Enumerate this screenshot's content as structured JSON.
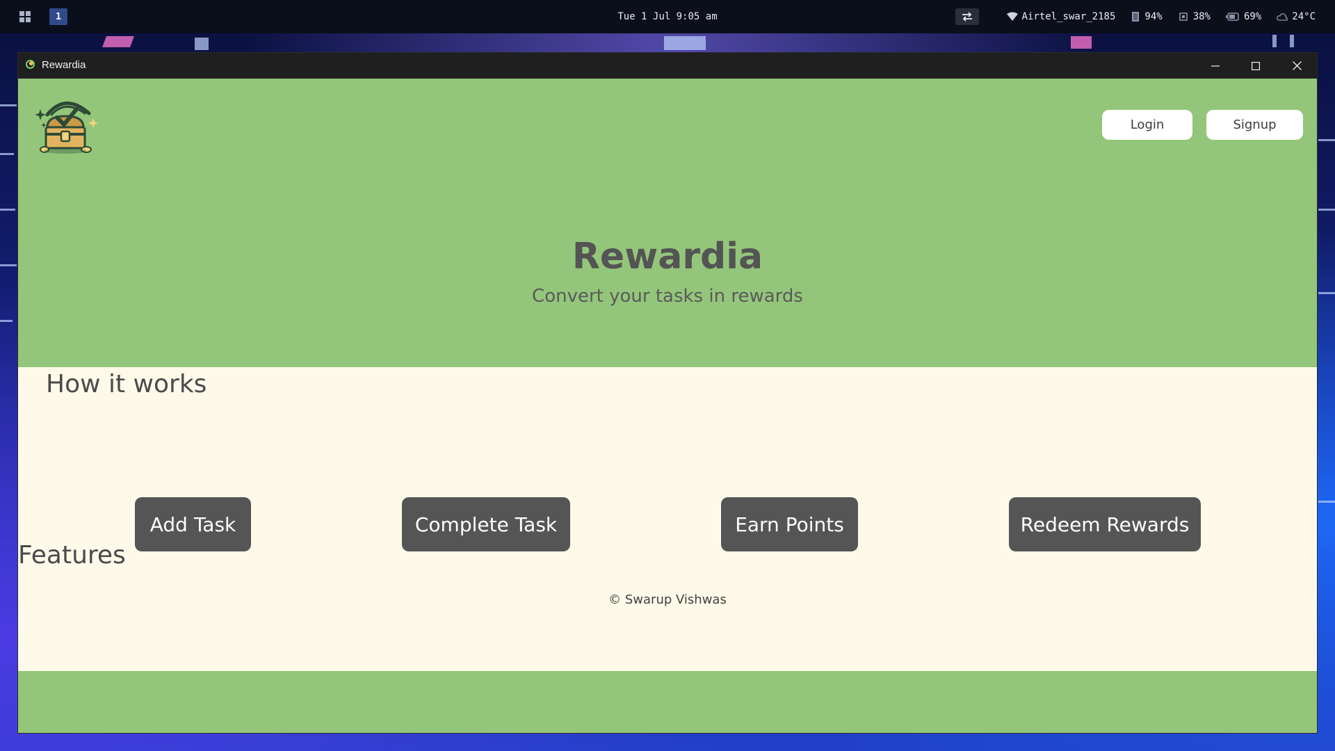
{
  "taskbar": {
    "workspace": "1",
    "clock": "Tue 1 Jul 9:05 am",
    "wifi": "Airtel_swar_2185",
    "memory": "94%",
    "cpu": "38%",
    "battery": "69%",
    "weather": "24°C"
  },
  "window": {
    "title": "Rewardia"
  },
  "header": {
    "login_label": "Login",
    "signup_label": "Signup"
  },
  "hero": {
    "title": "Rewardia",
    "subtitle": "Convert your tasks in rewards"
  },
  "how_it_works": {
    "heading": "How it works",
    "steps": [
      "Add Task",
      "Complete Task",
      "Earn Points",
      "Redeem Rewards"
    ]
  },
  "features": {
    "heading": "Features"
  },
  "footer": {
    "copyright": "© Swarup Vishwas"
  },
  "colors": {
    "brand_green": "#93c67a",
    "cream": "#fdfaea",
    "step_button": "#555555"
  }
}
